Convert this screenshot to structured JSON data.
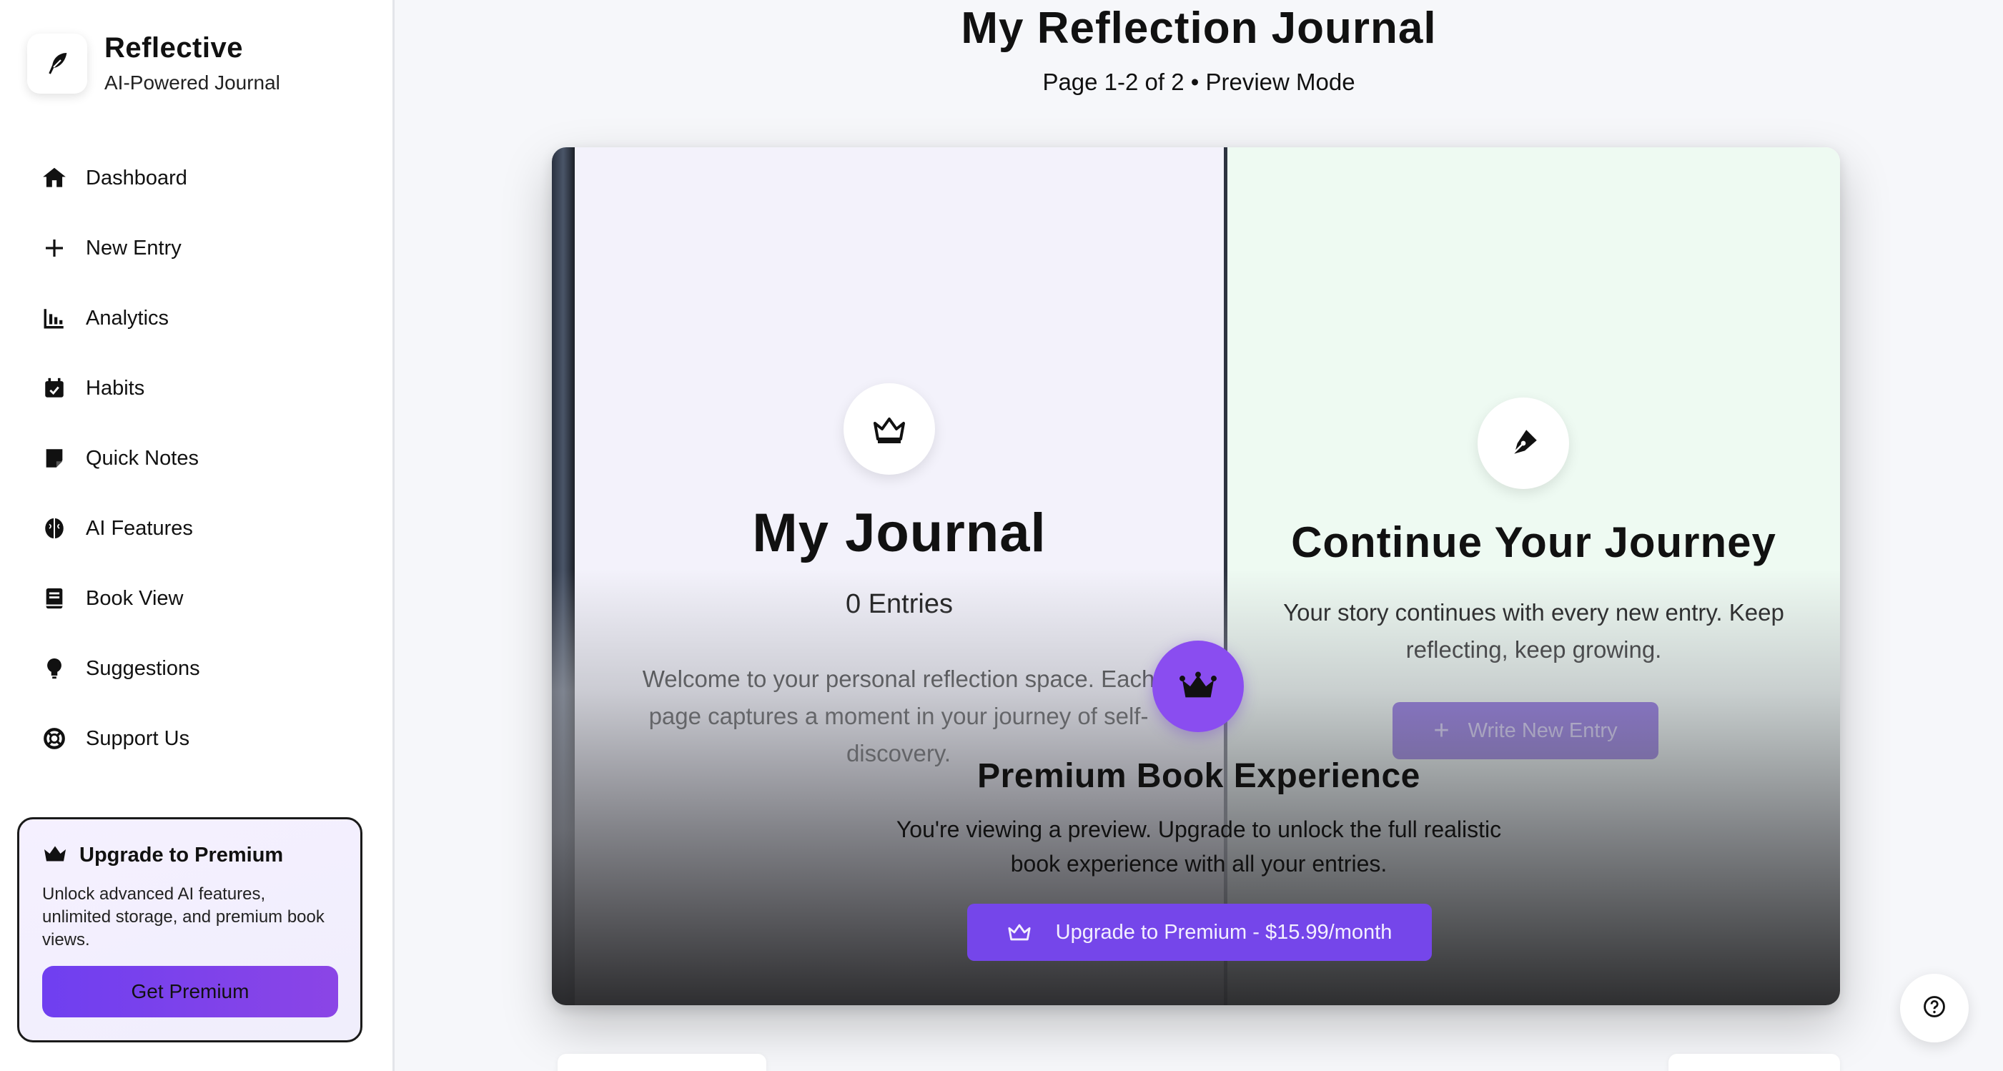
{
  "brand": {
    "title": "Reflective",
    "subtitle": "AI-Powered Journal",
    "logo_icon": "feather-icon"
  },
  "sidebar": {
    "items": [
      {
        "label": "Dashboard",
        "icon": "home-icon"
      },
      {
        "label": "New Entry",
        "icon": "plus-icon"
      },
      {
        "label": "Analytics",
        "icon": "bar-chart-icon"
      },
      {
        "label": "Habits",
        "icon": "calendar-check-icon"
      },
      {
        "label": "Quick Notes",
        "icon": "sticky-note-icon"
      },
      {
        "label": "AI Features",
        "icon": "brain-icon"
      },
      {
        "label": "Book View",
        "icon": "book-icon"
      },
      {
        "label": "Suggestions",
        "icon": "lightbulb-icon"
      },
      {
        "label": "Support Us",
        "icon": "lifebuoy-icon"
      }
    ]
  },
  "promo": {
    "title": "Upgrade to Premium",
    "body": "Unlock advanced AI features, unlimited storage, and premium book views.",
    "button": "Get Premium"
  },
  "main": {
    "title": "My Reflection Journal",
    "subtitle": "Page 1-2 of 2 • Preview Mode"
  },
  "book": {
    "left": {
      "title": "My Journal",
      "count": "0 Entries",
      "text": "Welcome to your personal reflection space. Each page captures a moment in your journey of self-discovery."
    },
    "right": {
      "title": "Continue Your Journey",
      "text": "Your story continues with every new entry. Keep reflecting, keep growing.",
      "button": "Write New Entry"
    }
  },
  "premium": {
    "title": "Premium Book Experience",
    "text": "You're viewing a preview. Upgrade to unlock the full realistic book experience with all your entries.",
    "button": "Upgrade to Premium - $15.99/month"
  },
  "colors": {
    "accent": "#7546ea",
    "accent_dark": "#5b2fd6",
    "badge": "#8a4df0"
  }
}
